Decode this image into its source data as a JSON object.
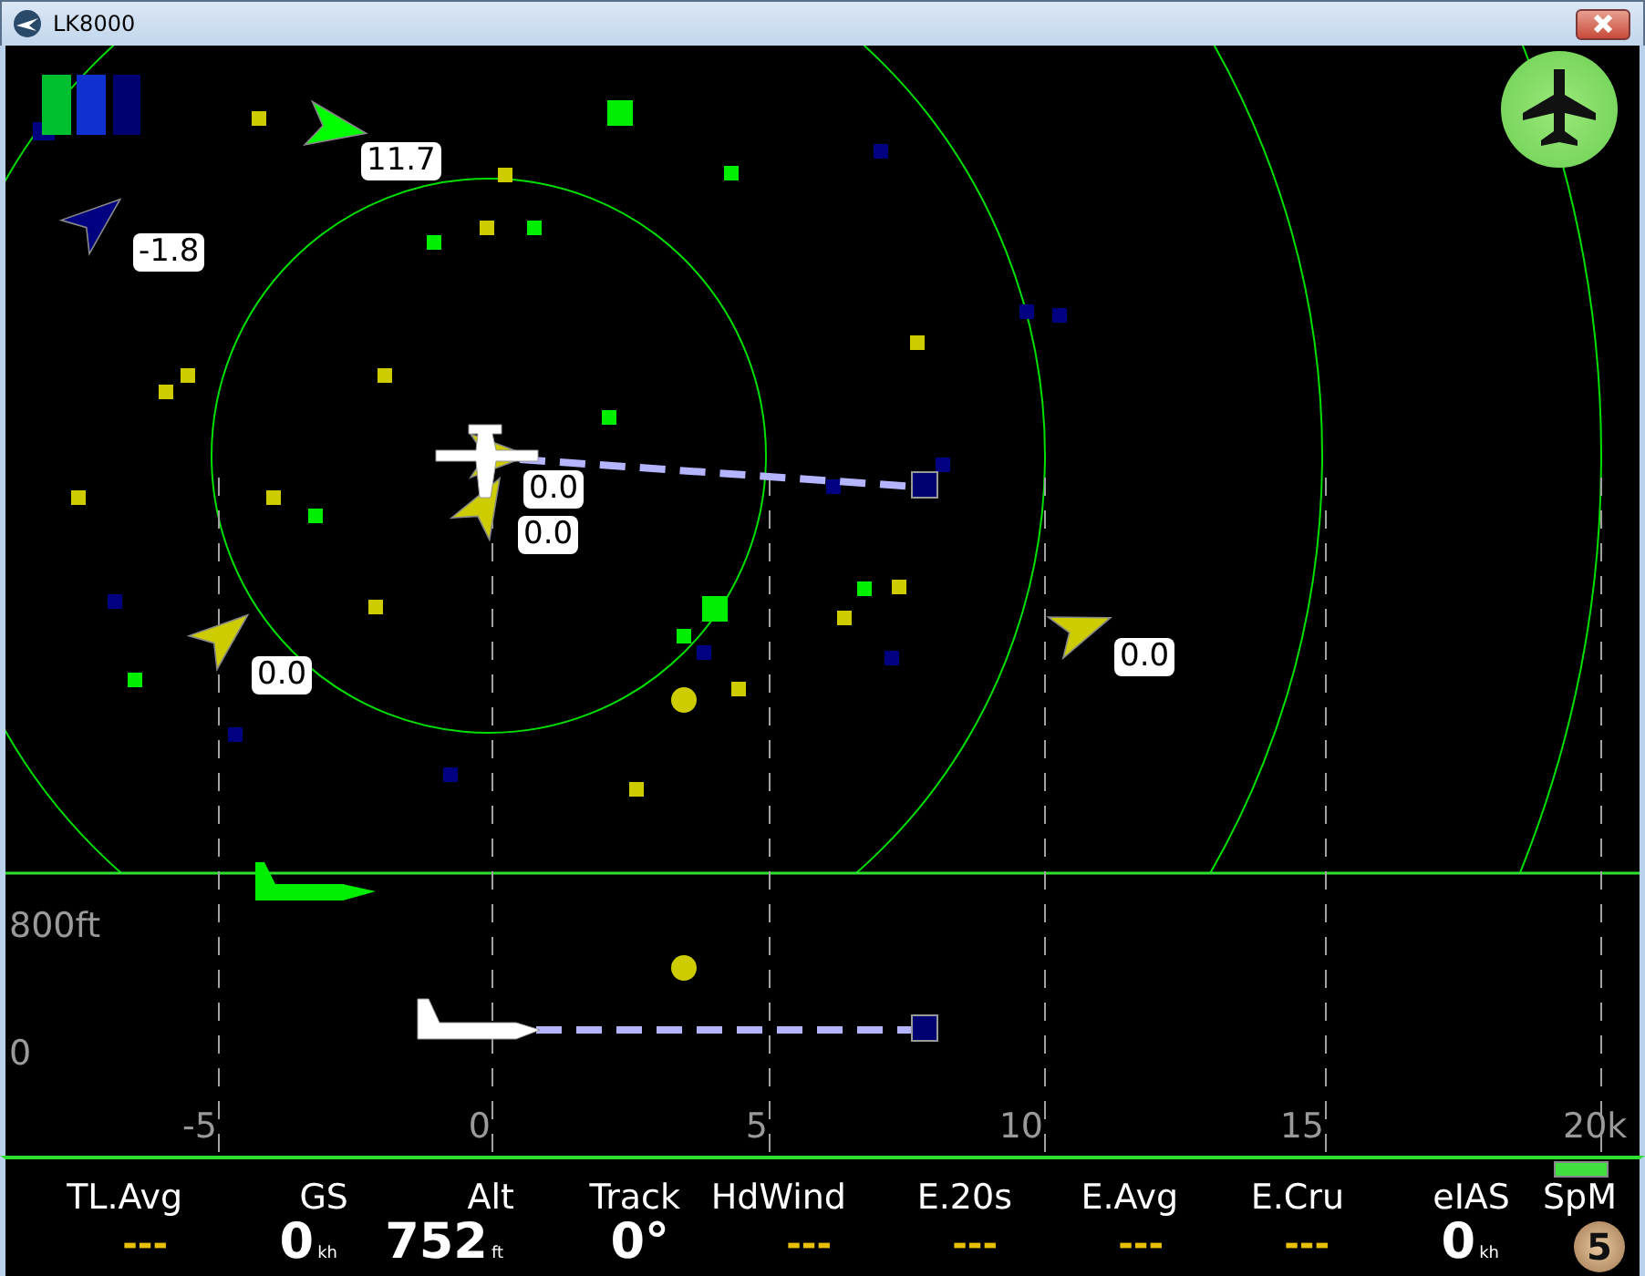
{
  "window": {
    "title": "LK8000"
  },
  "traffic": [
    {
      "label": "11.7",
      "color": "#00ff00"
    },
    {
      "label": "-1.8",
      "color": "#000080"
    },
    {
      "label": "0.0",
      "color": "#cccc00"
    },
    {
      "label": "0.0",
      "color": "#cccc00"
    },
    {
      "label": "0.0",
      "color": "#cccc00"
    },
    {
      "label": "0.0",
      "color": "#cccc00"
    }
  ],
  "profile": {
    "altitude_labels": [
      "800ft",
      "0"
    ]
  },
  "distance_axis": {
    "ticks": [
      "-5",
      "0",
      "5",
      "10",
      "15",
      "20k"
    ]
  },
  "infobar": [
    {
      "label": "TL.Avg",
      "kind": "blank",
      "value": "---"
    },
    {
      "label": "GS",
      "kind": "reading",
      "value": "0",
      "unit": "kh"
    },
    {
      "label": "Alt",
      "kind": "reading",
      "value": "752",
      "unit": "ft"
    },
    {
      "label": "Track",
      "kind": "reading",
      "value": "0°"
    },
    {
      "label": "HdWind",
      "kind": "blank",
      "value": "---"
    },
    {
      "label": "E.20s",
      "kind": "blank",
      "value": "---"
    },
    {
      "label": "E.Avg",
      "kind": "blank",
      "value": "---"
    },
    {
      "label": "E.Cru",
      "kind": "blank",
      "value": "---"
    },
    {
      "label": "eIAS",
      "kind": "reading",
      "value": "0",
      "unit": "kh"
    },
    {
      "label": "SpM",
      "kind": "cut"
    }
  ],
  "badge": "5"
}
